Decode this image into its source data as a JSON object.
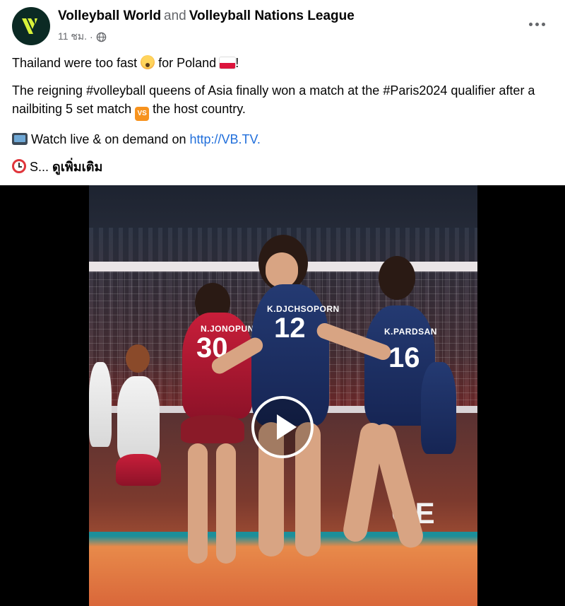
{
  "post": {
    "author": "Volleyball World",
    "connector": "and",
    "coauthor": "Volleyball Nations League",
    "time": "11 ชม.",
    "separator": "·",
    "audience_icon": "globe-icon",
    "more_icon": "more-options-icon"
  },
  "content": {
    "line1_before": "Thailand were too fast",
    "line1_middle": "for Poland",
    "line1_after": "!",
    "para2_before": "The reigning #volleyball queens of Asia finally won a match at the #Paris2024 qualifier after a nailbiting 5 set match",
    "para2_after": "the host country.",
    "watch_text": "Watch live & on demand on",
    "watch_link": "http://VB.TV.",
    "truncated_text": "S...",
    "see_more": "ดูเพิ่มเติม",
    "vs_label": "VS"
  },
  "media": {
    "type": "video",
    "play_icon": "play-icon",
    "jersey_left_name": "N.JONOPUN",
    "jersey_left_number": "30",
    "jersey_center_name": "K.DJCHSOPORN",
    "jersey_center_number": "12",
    "jersey_right_name": "K.PARDSAN",
    "jersey_right_number": "16",
    "board_text": "GE"
  },
  "colors": {
    "text": "#050505",
    "secondary": "#65676b",
    "link": "#216fdb",
    "avatar_bg": "#0b2a24",
    "logo_yellow": "#d8f23a"
  }
}
